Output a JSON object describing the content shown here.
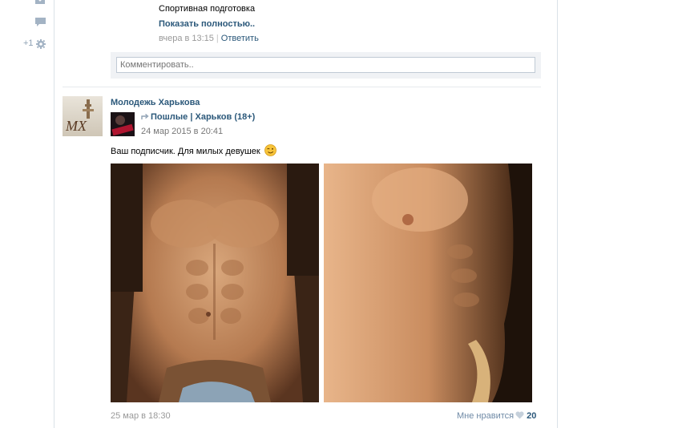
{
  "previous_comment": {
    "text": "Спортивная подготовка",
    "show_more": "Показать полностью..",
    "time": "вчера в 13:15",
    "separator": "|",
    "reply": "Ответить"
  },
  "comment_box": {
    "placeholder": "Комментировать.."
  },
  "left_rail": {
    "icons": [
      "envelope-icon",
      "comment-icon",
      "gear-icon"
    ],
    "plus_label": "+1"
  },
  "post": {
    "author": "Молодежь Харькова",
    "repost": {
      "source_name": "Пошлые | Харьков (18+)",
      "date": "24 мар 2015 в 20:41"
    },
    "text": "Ваш подписчик. Для милых девушек",
    "emoji": "wink-emoji",
    "photos": [
      {
        "label": "photo-1"
      },
      {
        "label": "photo-2"
      }
    ],
    "date": "25 мар в 18:30",
    "likes": {
      "label": "Мне нравится",
      "count": "20"
    }
  },
  "colors": {
    "link": "#2b587a",
    "muted": "#999999",
    "border": "#dae1e8",
    "comment_bg": "#f0f2f5"
  }
}
